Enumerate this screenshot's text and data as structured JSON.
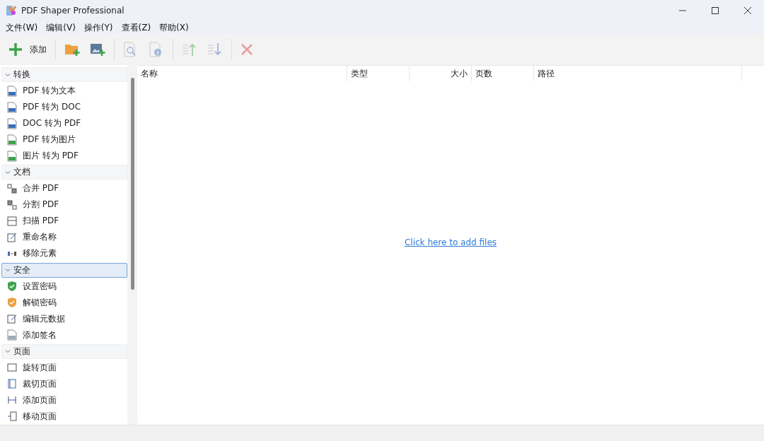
{
  "window": {
    "title": "PDF Shaper Professional"
  },
  "menu": [
    "文件(W)",
    "编辑(V)",
    "操作(Y)",
    "查看(Z)",
    "帮助(X)"
  ],
  "toolbar": [
    {
      "label": "添加",
      "disabled": false
    },
    {
      "disabled": false
    },
    {
      "disabled": false
    },
    {
      "disabled": true
    },
    {
      "disabled": true
    },
    {
      "disabled": true
    },
    {
      "disabled": true
    },
    {
      "disabled": true
    }
  ],
  "sidebar": {
    "groups": [
      {
        "label": "转换",
        "expanded": true,
        "selected": false,
        "items": [
          "PDF 转为文本",
          "PDF 转为 DOC",
          "DOC 转为 PDF",
          "PDF 转为图片",
          "图片 转为 PDF"
        ]
      },
      {
        "label": "文档",
        "expanded": true,
        "selected": false,
        "items": [
          "合并 PDF",
          "分割 PDF",
          "扫描 PDF",
          "重命名称",
          "移除元素"
        ]
      },
      {
        "label": "安全",
        "expanded": true,
        "selected": true,
        "items": [
          "设置密码",
          "解锁密码",
          "编辑元数据",
          "添加签名"
        ]
      },
      {
        "label": "页面",
        "expanded": true,
        "selected": false,
        "items": [
          "旋转页面",
          "裁切页面",
          "添加页面",
          "移动页面"
        ]
      }
    ]
  },
  "table": {
    "columns": [
      "名称",
      "类型",
      "大小",
      "页数",
      "路径"
    ],
    "empty_link": "Click here to add files"
  }
}
